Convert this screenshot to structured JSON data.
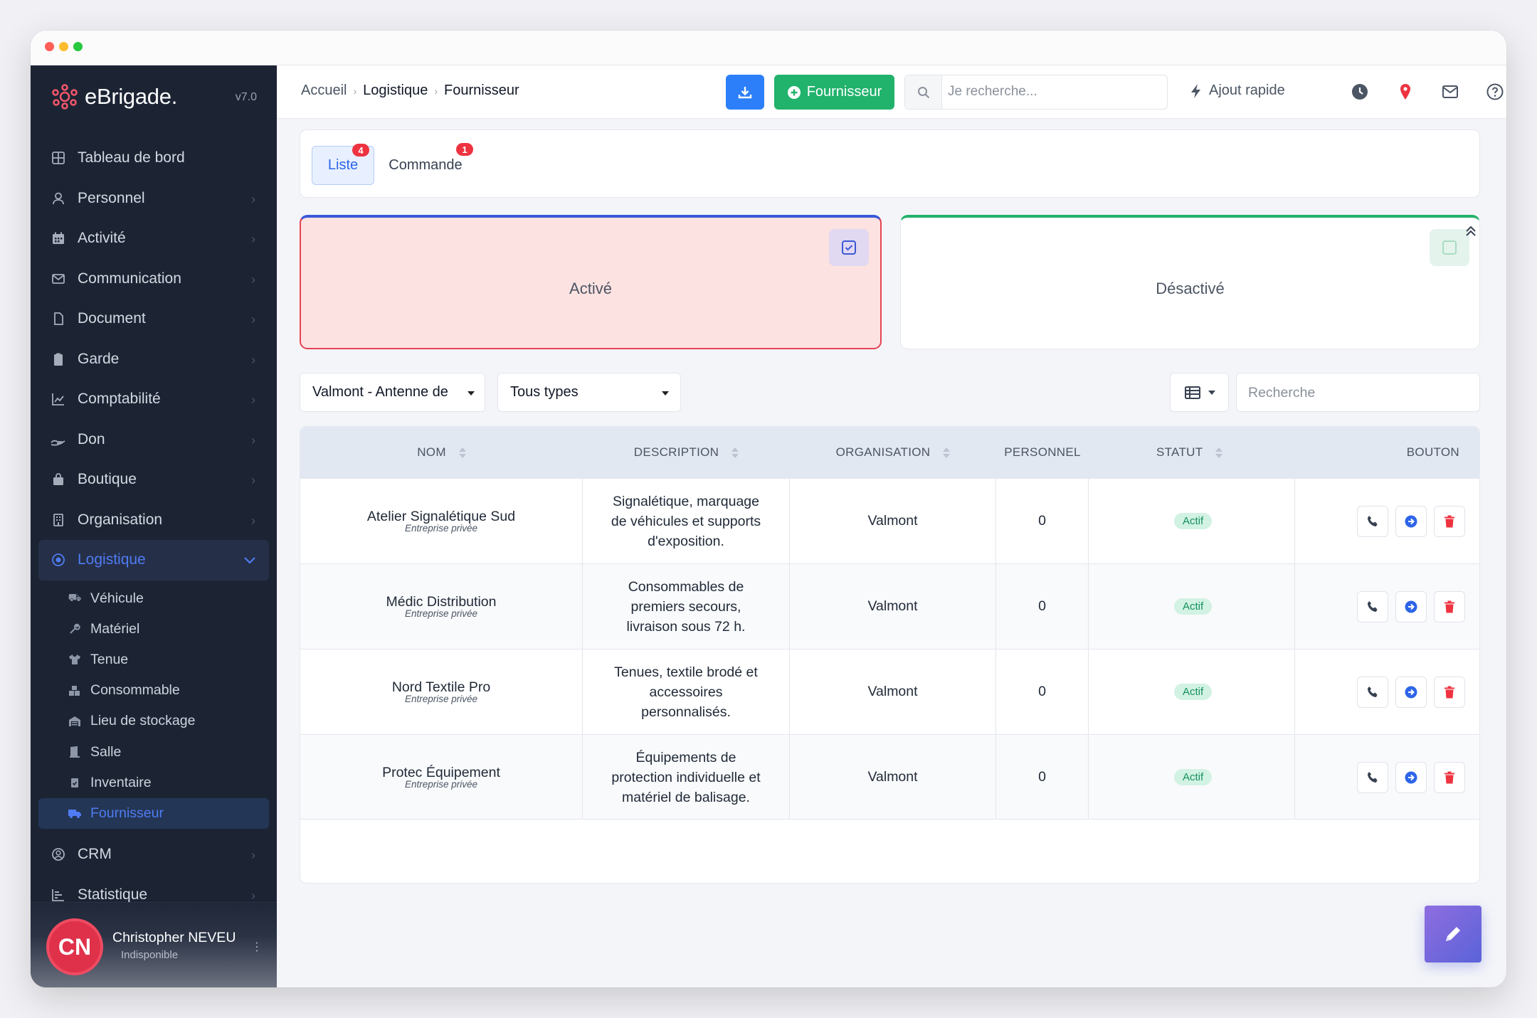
{
  "app": {
    "name": "eBrigade.",
    "version": "v7.0"
  },
  "sidebar": {
    "items": [
      {
        "label": "Tableau de bord",
        "icon": "dashboard-icon"
      },
      {
        "label": "Personnel",
        "icon": "user-icon"
      },
      {
        "label": "Activité",
        "icon": "calendar-icon"
      },
      {
        "label": "Communication",
        "icon": "mail-icon"
      },
      {
        "label": "Document",
        "icon": "file-icon"
      },
      {
        "label": "Garde",
        "icon": "clipboard-icon"
      },
      {
        "label": "Comptabilité",
        "icon": "chart-line-icon"
      },
      {
        "label": "Don",
        "icon": "hand-icon"
      },
      {
        "label": "Boutique",
        "icon": "bag-icon"
      },
      {
        "label": "Organisation",
        "icon": "building-icon"
      },
      {
        "label": "Logistique",
        "icon": "target-icon"
      }
    ],
    "logistique_sub": [
      {
        "label": "Véhicule",
        "icon": "truck-icon"
      },
      {
        "label": "Matériel",
        "icon": "wrench-icon"
      },
      {
        "label": "Tenue",
        "icon": "shirt-icon"
      },
      {
        "label": "Consommable",
        "icon": "boxes-icon"
      },
      {
        "label": "Lieu de stockage",
        "icon": "warehouse-icon"
      },
      {
        "label": "Salle",
        "icon": "door-icon"
      },
      {
        "label": "Inventaire",
        "icon": "clipboard-check-icon"
      },
      {
        "label": "Fournisseur",
        "icon": "truck-icon"
      }
    ],
    "bottom_items": [
      {
        "label": "CRM",
        "icon": "user-circle-icon"
      },
      {
        "label": "Statistique",
        "icon": "bar-chart-icon"
      }
    ],
    "user": {
      "initials": "CN",
      "name": "Christopher NEVEU",
      "status": "Indisponible"
    }
  },
  "topbar": {
    "breadcrumb": [
      "Accueil",
      "Logistique",
      "Fournisseur"
    ],
    "add_button": "Fournisseur",
    "search_placeholder": "Je recherche...",
    "quick_add": "Ajout rapide"
  },
  "tabs": [
    {
      "label": "Liste",
      "badge": "4"
    },
    {
      "label": "Commande",
      "badge": "1"
    }
  ],
  "status_cards": {
    "active": "Activé",
    "inactive": "Désactivé"
  },
  "filters": {
    "organisation": "Valmont - Antenne de",
    "type": "Tous types",
    "search_placeholder": "Recherche"
  },
  "table": {
    "headers": [
      "NOM",
      "DESCRIPTION",
      "ORGANISATION",
      "PERSONNEL",
      "STATUT",
      "BOUTON"
    ],
    "rows": [
      {
        "name": "Atelier Signalétique Sud",
        "kind": "Entreprise privée",
        "desc": [
          "Signalétique, marquage",
          "de véhicules et supports",
          "d'exposition."
        ],
        "org": "Valmont",
        "personnel": "0",
        "status": "Actif"
      },
      {
        "name": "Médic Distribution",
        "kind": "Entreprise privée",
        "desc": [
          "Consommables de",
          "premiers secours,",
          "livraison sous 72 h."
        ],
        "org": "Valmont",
        "personnel": "0",
        "status": "Actif"
      },
      {
        "name": "Nord Textile Pro",
        "kind": "Entreprise privée",
        "desc": [
          "Tenues, textile brodé et",
          "accessoires",
          "personnalisés."
        ],
        "org": "Valmont",
        "personnel": "0",
        "status": "Actif"
      },
      {
        "name": "Protec Équipement",
        "kind": "Entreprise privée",
        "desc": [
          "Équipements de",
          "protection individuelle et",
          "matériel de balisage."
        ],
        "org": "Valmont",
        "personnel": "0",
        "status": "Actif"
      }
    ]
  },
  "colors": {
    "primary": "#2d7ff9",
    "success": "#21b26c",
    "danger": "#ee3340",
    "sidebar": "#1c2434"
  }
}
